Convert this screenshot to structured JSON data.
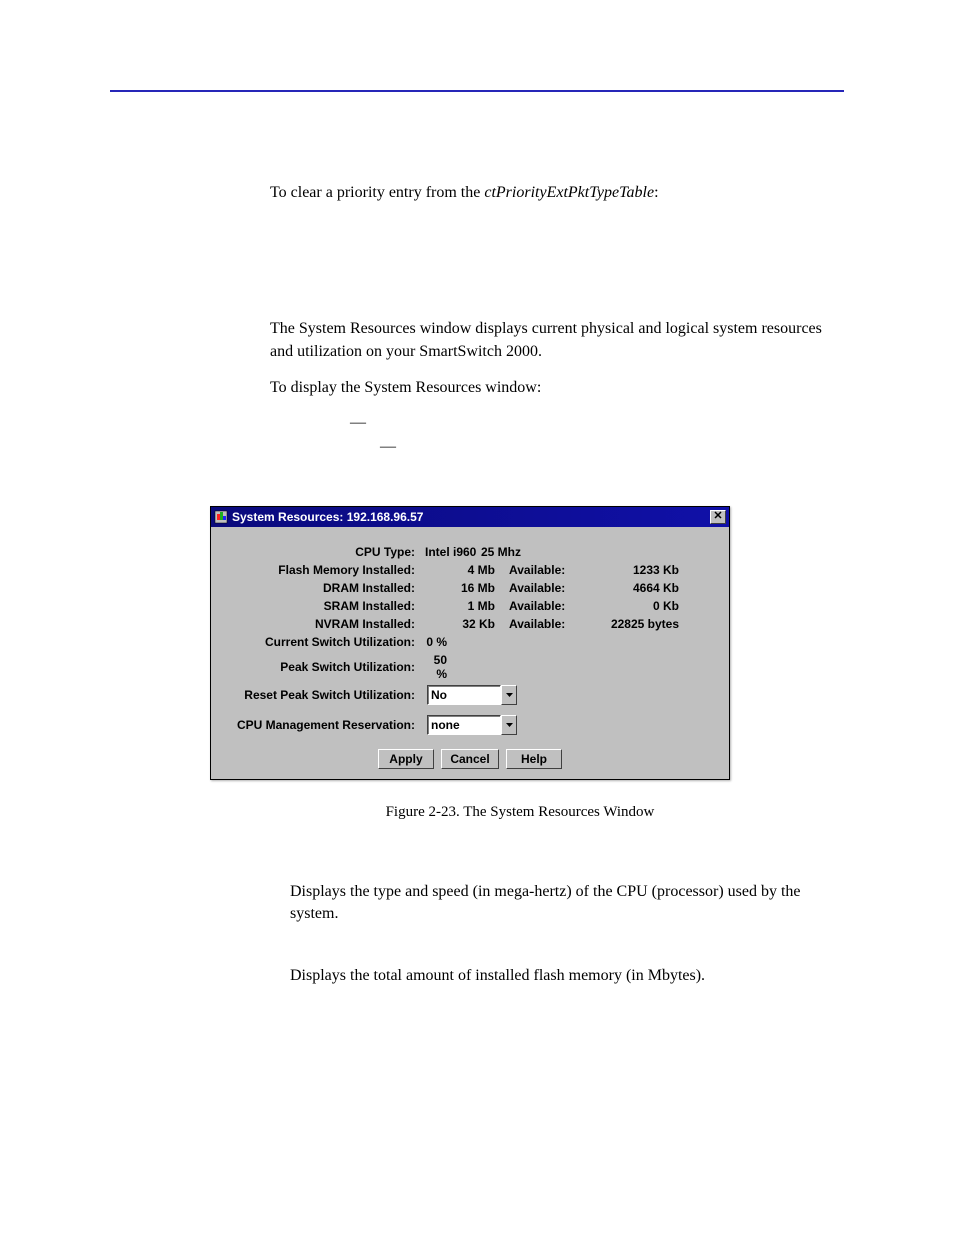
{
  "intro": {
    "line1_pre": "To clear a priority entry from the ",
    "line1_italic": "ctPriorityExtPktTypeTable",
    "line1_post": ":"
  },
  "section2": {
    "p1": "The System Resources window displays current physical and logical system resources and utilization on your SmartSwitch 2000.",
    "p2": "To display the System Resources window:"
  },
  "steps": {
    "dash1": "—",
    "dash2": "—"
  },
  "window": {
    "title": "System Resources: 192.168.96.57",
    "labels": {
      "cpu": "CPU Type:",
      "flash": "Flash Memory Installed:",
      "dram": "DRAM Installed:",
      "sram": "SRAM Installed:",
      "nvram": "NVRAM Installed:",
      "cur_switch": "Current Switch Utilization:",
      "peak_switch": "Peak Switch Utilization:",
      "reset_peak": "Reset Peak Switch Utilization:",
      "cpu_mgmt": "CPU Management Reservation:"
    },
    "vals": {
      "cpu_type": "Intel i960",
      "cpu_mhz": "25 Mhz",
      "flash_inst": "4 Mb",
      "flash_avail": "1233 Kb",
      "dram_inst": "16 Mb",
      "dram_avail": "4664 Kb",
      "sram_inst": "1 Mb",
      "sram_avail": "0 Kb",
      "nvram_inst": "32 Kb",
      "nvram_avail": "22825 bytes",
      "cur_switch": "0 %",
      "peak_switch": "50 %",
      "available_label": "Available:",
      "reset_peak_sel": "No",
      "cpu_mgmt_sel": "none"
    },
    "buttons": {
      "apply": "Apply",
      "cancel": "Cancel",
      "help": "Help"
    }
  },
  "caption": "Figure 2-23.  The System Resources Window",
  "defs": {
    "cpu": "Displays the type and speed (in mega-hertz) of the CPU (processor) used by the system.",
    "flash": "Displays the total amount of installed flash memory (in Mbytes)."
  }
}
